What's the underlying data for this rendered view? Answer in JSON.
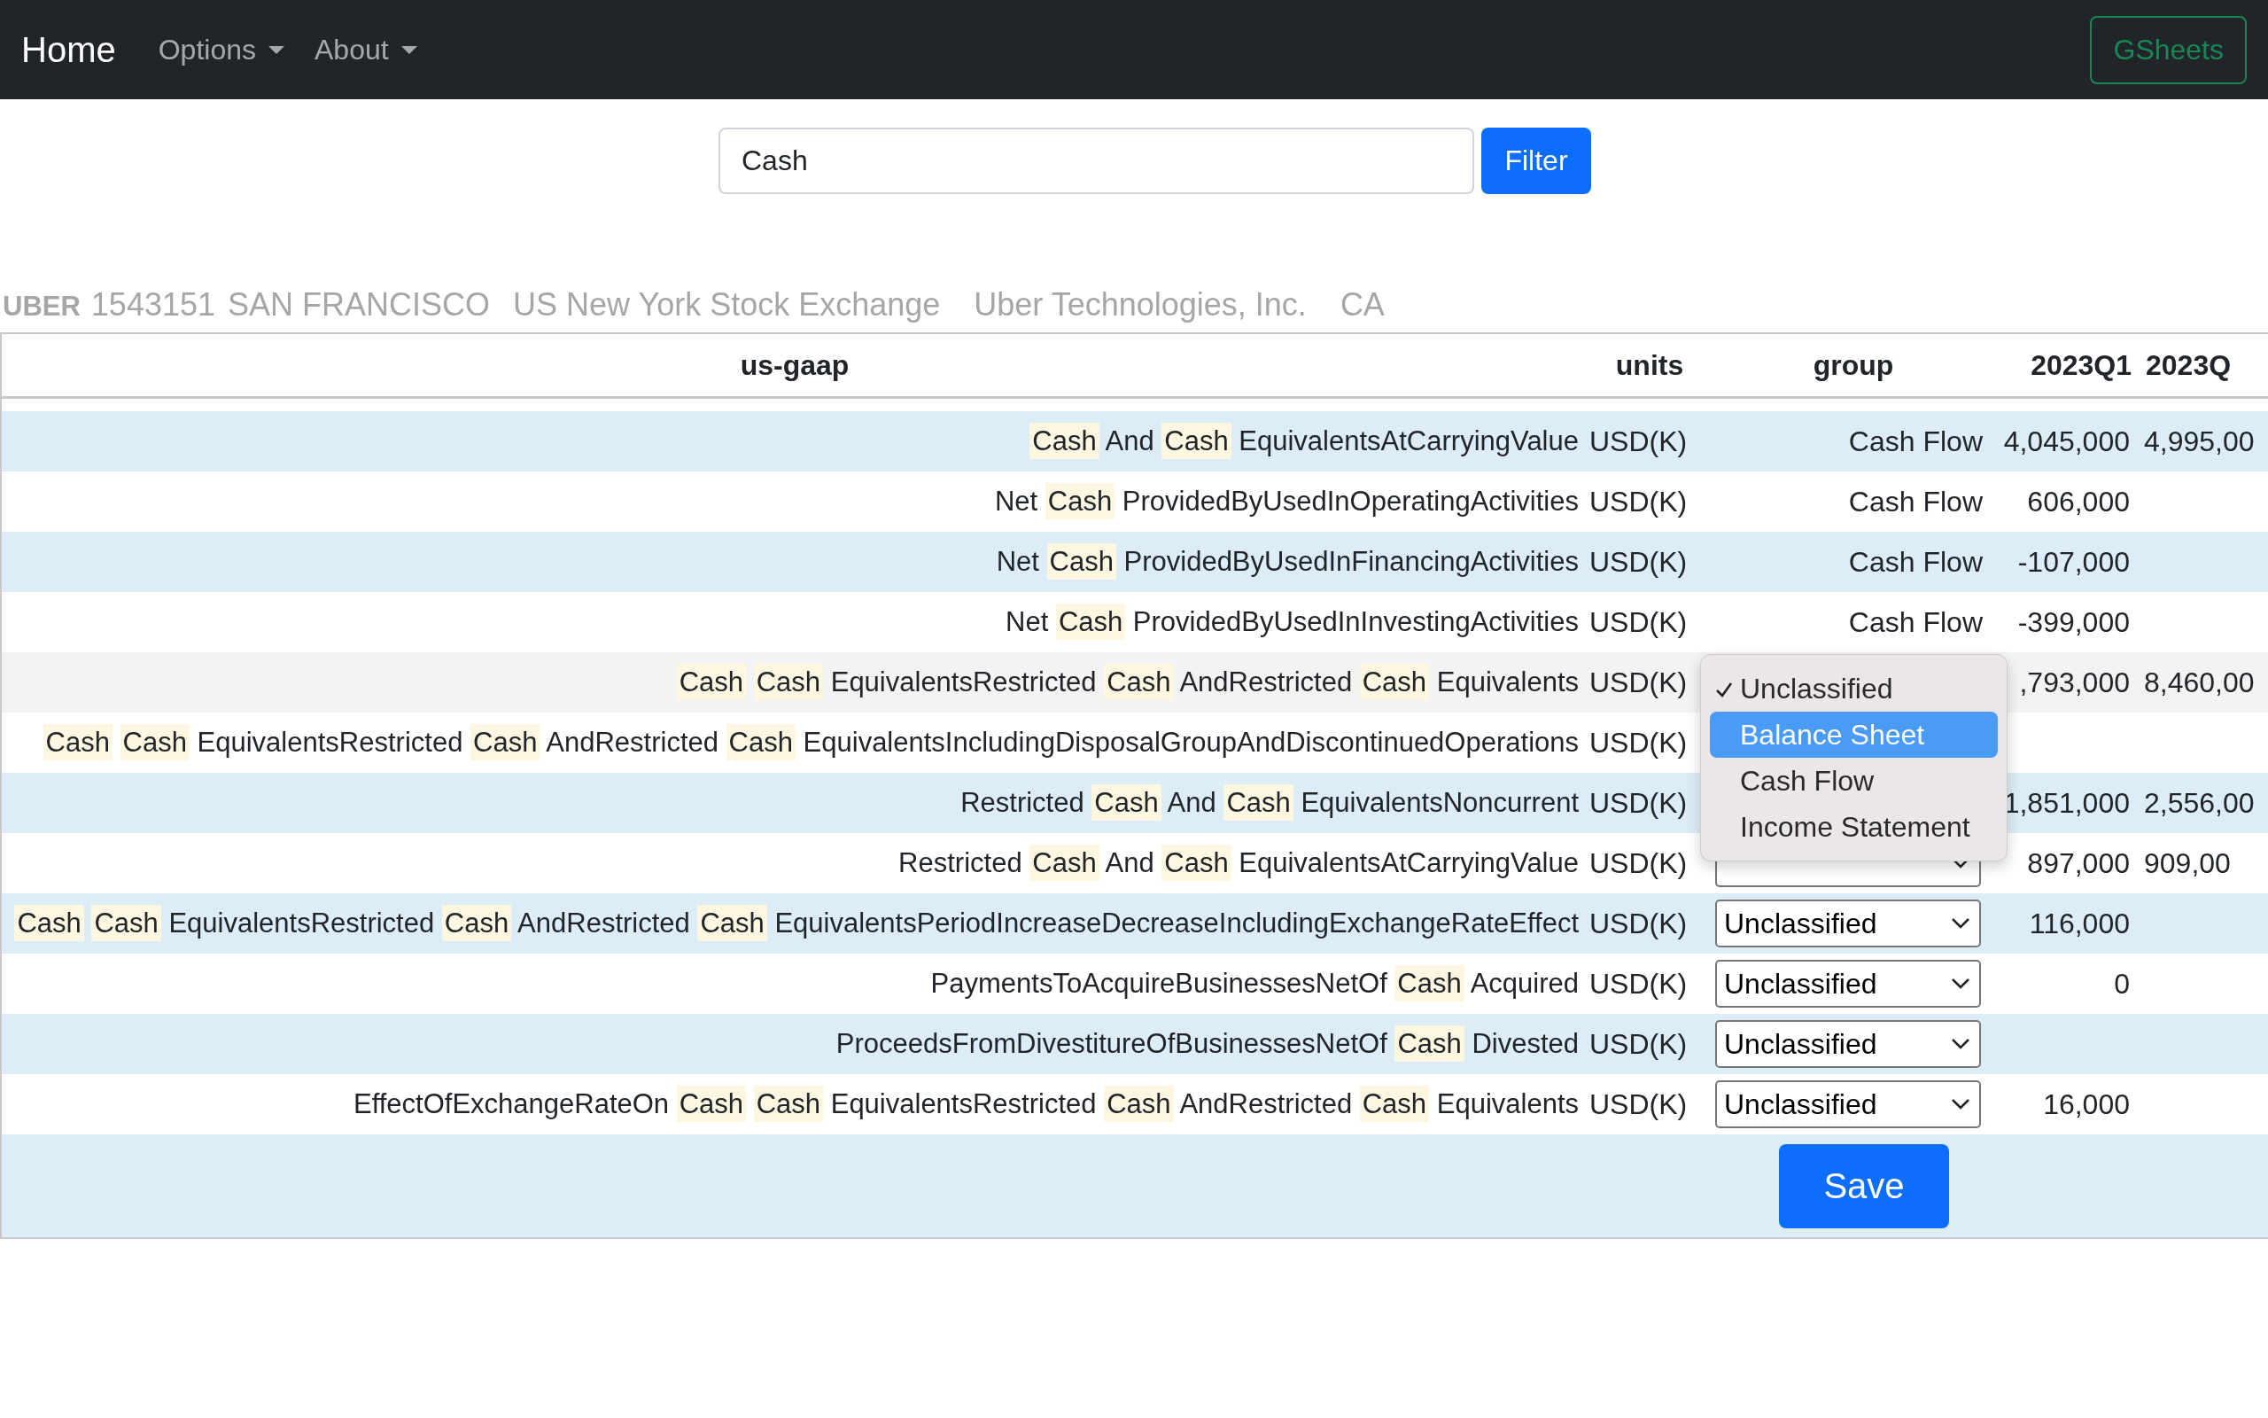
{
  "navbar": {
    "brand": "Home",
    "menus": [
      {
        "label": "Options"
      },
      {
        "label": "About"
      }
    ],
    "action": "GSheets"
  },
  "filter": {
    "value": "Cash",
    "button": "Filter"
  },
  "company": {
    "ticker": "UBER",
    "cik": "1543151",
    "city": "SAN FRANCISCO",
    "exchange": "US New York Stock Exchange",
    "name": "Uber Technologies, Inc.",
    "state": "CA"
  },
  "table": {
    "columns": [
      "us-gaap",
      "units",
      "group",
      "2023Q1",
      "2023Q"
    ],
    "rows": [
      {
        "hovered": false,
        "concept": [
          {
            "text": "Cash",
            "kind": "match"
          },
          {
            "text": "And",
            "kind": "plain"
          },
          {
            "text": "Cash",
            "kind": "match"
          },
          {
            "text": "EquivalentsAtCarryingValue",
            "kind": "plain"
          }
        ],
        "units": "USD(K)",
        "group": {
          "kind": "text",
          "value": "Cash Flow"
        },
        "values": [
          "4,045,000",
          "4,995,00"
        ]
      },
      {
        "hovered": false,
        "concept": [
          {
            "text": "Net",
            "kind": "plain"
          },
          {
            "text": "Cash",
            "kind": "match"
          },
          {
            "text": "ProvidedByUsedInOperatingActivities",
            "kind": "plain"
          }
        ],
        "units": "USD(K)",
        "group": {
          "kind": "text",
          "value": "Cash Flow"
        },
        "values": [
          "606,000"
        ]
      },
      {
        "hovered": false,
        "concept": [
          {
            "text": "Net",
            "kind": "plain"
          },
          {
            "text": "Cash",
            "kind": "match"
          },
          {
            "text": "ProvidedByUsedInFinancingActivities",
            "kind": "plain"
          }
        ],
        "units": "USD(K)",
        "group": {
          "kind": "text",
          "value": "Cash Flow"
        },
        "values": [
          "-107,000"
        ]
      },
      {
        "hovered": false,
        "concept": [
          {
            "text": "Net",
            "kind": "plain"
          },
          {
            "text": "Cash",
            "kind": "match"
          },
          {
            "text": "ProvidedByUsedInInvestingActivities",
            "kind": "plain"
          }
        ],
        "units": "USD(K)",
        "group": {
          "kind": "text",
          "value": "Cash Flow"
        },
        "values": [
          "-399,000"
        ]
      },
      {
        "hovered": true,
        "concept": [
          {
            "text": "Cash",
            "kind": "match"
          },
          {
            "text": "Cash",
            "kind": "match"
          },
          {
            "text": "EquivalentsRestricted",
            "kind": "plain"
          },
          {
            "text": "Cash",
            "kind": "match"
          },
          {
            "text": "AndRestricted",
            "kind": "plain"
          },
          {
            "text": "Cash",
            "kind": "match"
          },
          {
            "text": "Equivalents",
            "kind": "plain"
          }
        ],
        "units": "USD(K)",
        "group": {
          "kind": "menu",
          "options": [
            {
              "label": "Unclassified",
              "checked": true,
              "selected": false
            },
            {
              "label": "Balance Sheet",
              "checked": false,
              "selected": true
            },
            {
              "label": "Cash Flow",
              "checked": false,
              "selected": false
            },
            {
              "label": "Income Statement",
              "checked": false,
              "selected": false
            }
          ]
        },
        "values": [
          ",793,000",
          "8,460,00"
        ]
      },
      {
        "hovered": false,
        "concept": [
          {
            "text": "Cash",
            "kind": "match"
          },
          {
            "text": "Cash",
            "kind": "match"
          },
          {
            "text": "EquivalentsRestricted",
            "kind": "plain"
          },
          {
            "text": "Cash",
            "kind": "match"
          },
          {
            "text": "AndRestricted",
            "kind": "plain"
          },
          {
            "text": "Cash",
            "kind": "match"
          },
          {
            "text": "EquivalentsIncludingDisposalGroupAndDiscontinuedOperations",
            "kind": "plain"
          }
        ],
        "units": "USD(K)",
        "group": {
          "kind": "hidden"
        },
        "values": []
      },
      {
        "hovered": false,
        "concept": [
          {
            "text": "Restricted",
            "kind": "plain"
          },
          {
            "text": "Cash",
            "kind": "match"
          },
          {
            "text": "And",
            "kind": "plain"
          },
          {
            "text": "Cash",
            "kind": "match"
          },
          {
            "text": "EquivalentsNoncurrent",
            "kind": "plain"
          }
        ],
        "units": "USD(K)",
        "group": {
          "kind": "hidden"
        },
        "values": [
          "1,851,000",
          "2,556,00"
        ]
      },
      {
        "hovered": false,
        "concept": [
          {
            "text": "Restricted",
            "kind": "plain"
          },
          {
            "text": "Cash",
            "kind": "match"
          },
          {
            "text": "And",
            "kind": "plain"
          },
          {
            "text": "Cash",
            "kind": "match"
          },
          {
            "text": "EquivalentsAtCarryingValue",
            "kind": "plain"
          }
        ],
        "units": "USD(K)",
        "group": {
          "kind": "covered-select"
        },
        "values": [
          "897,000",
          "909,00"
        ]
      },
      {
        "hovered": false,
        "concept": [
          {
            "text": "Cash",
            "kind": "match"
          },
          {
            "text": "Cash",
            "kind": "match"
          },
          {
            "text": "EquivalentsRestricted",
            "kind": "plain"
          },
          {
            "text": "Cash",
            "kind": "match"
          },
          {
            "text": "AndRestricted",
            "kind": "plain"
          },
          {
            "text": "Cash",
            "kind": "match"
          },
          {
            "text": "EquivalentsPeriodIncreaseDecreaseIncludingExchangeRateEffect",
            "kind": "plain"
          }
        ],
        "units": "USD(K)",
        "group": {
          "kind": "select",
          "value": "Unclassified"
        },
        "values": [
          "116,000"
        ]
      },
      {
        "hovered": false,
        "concept": [
          {
            "text": "PaymentsToAcquireBusinessesNetOf",
            "kind": "plain"
          },
          {
            "text": "Cash",
            "kind": "match"
          },
          {
            "text": "Acquired",
            "kind": "plain"
          }
        ],
        "units": "USD(K)",
        "group": {
          "kind": "select",
          "value": "Unclassified"
        },
        "values": [
          "0"
        ]
      },
      {
        "hovered": false,
        "concept": [
          {
            "text": "ProceedsFromDivestitureOfBusinessesNetOf",
            "kind": "plain"
          },
          {
            "text": "Cash",
            "kind": "match"
          },
          {
            "text": "Divested",
            "kind": "plain"
          }
        ],
        "units": "USD(K)",
        "group": {
          "kind": "select",
          "value": "Unclassified"
        },
        "values": []
      },
      {
        "hovered": false,
        "concept": [
          {
            "text": "EffectOfExchangeRateOn",
            "kind": "plain"
          },
          {
            "text": "Cash",
            "kind": "match"
          },
          {
            "text": "Cash",
            "kind": "match"
          },
          {
            "text": "EquivalentsRestricted",
            "kind": "plain"
          },
          {
            "text": "Cash",
            "kind": "match"
          },
          {
            "text": "AndRestricted",
            "kind": "plain"
          },
          {
            "text": "Cash",
            "kind": "match"
          },
          {
            "text": "Equivalents",
            "kind": "plain"
          }
        ],
        "units": "USD(K)",
        "group": {
          "kind": "select",
          "value": "Unclassified"
        },
        "values": [
          "16,000"
        ]
      }
    ],
    "save": "Save"
  }
}
